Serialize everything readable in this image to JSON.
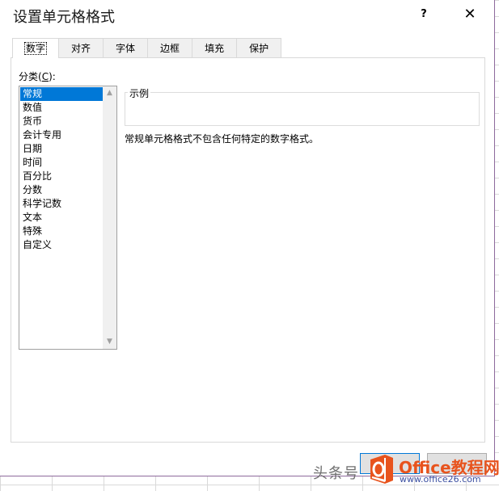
{
  "dialog": {
    "title": "设置单元格格式",
    "help_label": "?",
    "close_label": "✕"
  },
  "tabs": [
    {
      "label": "数字",
      "active": true
    },
    {
      "label": "对齐"
    },
    {
      "label": "字体"
    },
    {
      "label": "边框"
    },
    {
      "label": "填充"
    },
    {
      "label": "保护"
    }
  ],
  "category": {
    "label_prefix": "分类(",
    "label_key": "C",
    "label_suffix": "):",
    "items": [
      "常规",
      "数值",
      "货币",
      "会计专用",
      "日期",
      "时间",
      "百分比",
      "分数",
      "科学记数",
      "文本",
      "特殊",
      "自定义"
    ],
    "selected": "常规"
  },
  "sample": {
    "legend": "示例"
  },
  "description": "常规单元格格式不包含任何特定的数字格式。",
  "watermark": {
    "text": "头条号",
    "brand": "Office教程网",
    "url": "www.office26.com",
    "brand_color": "#e8531d"
  },
  "colors": {
    "selection": "#0078d7",
    "accent": "#8e6a9c"
  }
}
